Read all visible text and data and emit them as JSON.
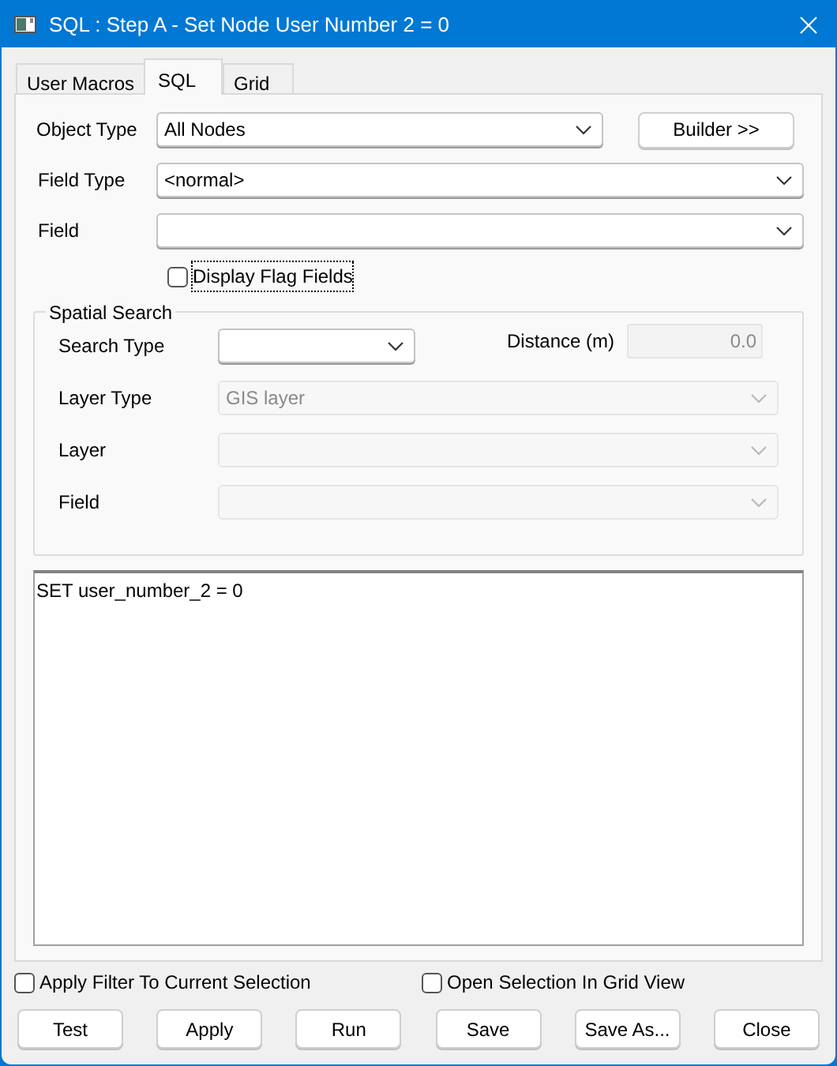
{
  "window": {
    "title": "SQL : Step A - Set Node User Number 2 = 0"
  },
  "tabs": [
    {
      "label": "User Macros",
      "selected": false
    },
    {
      "label": "SQL",
      "selected": true
    },
    {
      "label": "Grid",
      "selected": false
    }
  ],
  "object_type": {
    "label": "Object Type",
    "value": "All Nodes"
  },
  "builder_button": "Builder >>",
  "field_type": {
    "label": "Field Type",
    "value": "<normal>"
  },
  "field": {
    "label": "Field"
  },
  "display_flag_fields": {
    "label": "Display Flag Fields",
    "checked": false
  },
  "spatial_search": {
    "title": "Spatial Search",
    "search_type": {
      "label": "Search Type",
      "disabled": false
    },
    "distance": {
      "label": "Distance (m)",
      "value": "0.0",
      "disabled": true
    },
    "rows": [
      {
        "label": "Layer Type",
        "value": "GIS layer",
        "disabled": true
      },
      {
        "label": "Layer",
        "disabled": true
      },
      {
        "label": "Field",
        "disabled": true
      }
    ]
  },
  "sql_text": "SET user_number_2 = 0",
  "options": [
    {
      "label": "Apply Filter To Current Selection",
      "checked": false
    },
    {
      "label": "Open Selection In Grid View",
      "checked": false
    }
  ],
  "buttons": [
    "Test",
    "Apply",
    "Run",
    "Save",
    "Save As...",
    "Close"
  ]
}
